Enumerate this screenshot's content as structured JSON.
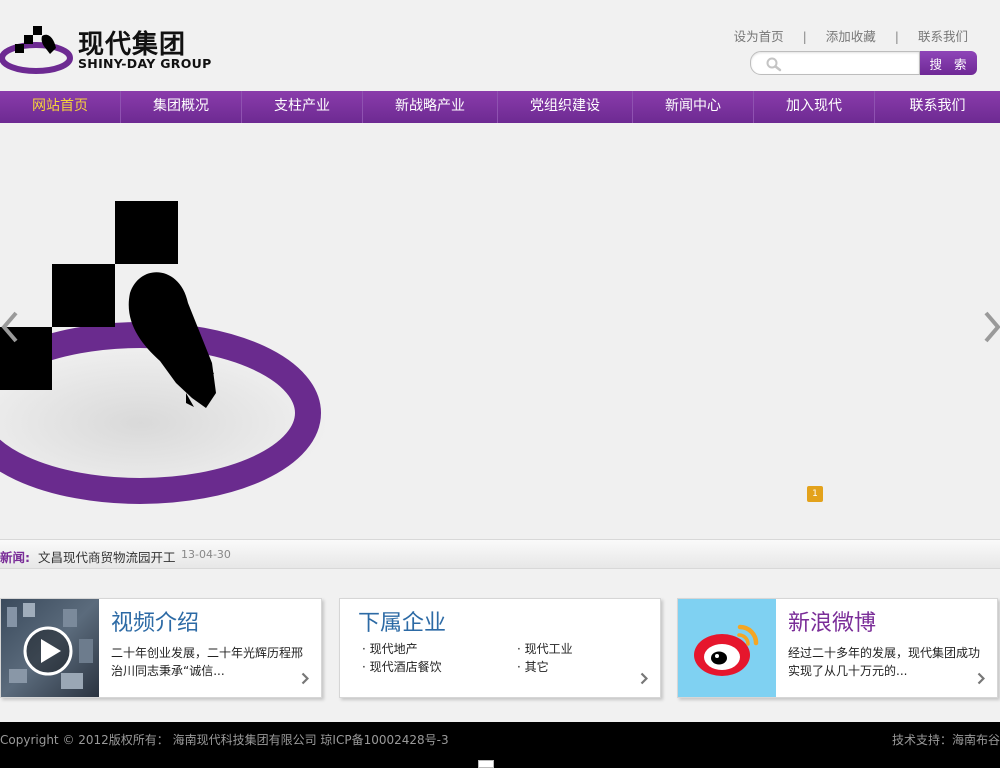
{
  "header": {
    "logo": {
      "title_cn": "现代集团",
      "title_en": "SHINY-DAY GROUP",
      "icon": "ink-brush-logo-icon",
      "colors": {
        "ring": "#6d2a92",
        "mark": "#000000"
      }
    },
    "top_links": [
      {
        "label": "设为首页"
      },
      {
        "label": "添加收藏"
      },
      {
        "label": "联系我们"
      }
    ],
    "separator": "|",
    "search": {
      "value": "",
      "placeholder": "",
      "button_label": "搜 索",
      "icon": "search-icon"
    }
  },
  "nav": {
    "colors": {
      "background": "#7a2d98",
      "active_text": "#f5d23c",
      "text": "#ffffff"
    },
    "items": [
      {
        "label": "网站首页",
        "active": true
      },
      {
        "label": "集团概况"
      },
      {
        "label": "支柱产业"
      },
      {
        "label": "新战略产业"
      },
      {
        "label": "党组织建设"
      },
      {
        "label": "新闻中心"
      },
      {
        "label": "加入现代"
      },
      {
        "label": "联系我们"
      }
    ]
  },
  "banner": {
    "slide_indicator": "1",
    "prev_icon": "chevron-left-icon",
    "next_icon": "chevron-right-icon",
    "image_icon": "ink-brush-logo-icon"
  },
  "news": {
    "label": "新闻:",
    "title": "文昌现代商贸物流园开工",
    "date": "13-04-30"
  },
  "boxes": {
    "video": {
      "title": "视频介绍",
      "text": "二十年创业发展，二十年光辉历程邢治川同志秉承“诚信...",
      "thumb_icon": "play-icon",
      "more_icon": "chevron-right-icon"
    },
    "corp": {
      "title": "下属企业",
      "items": [
        "· 现代地产",
        "· 现代工业",
        "· 现代酒店餐饮",
        "· 其它"
      ],
      "more_icon": "chevron-right-icon"
    },
    "weibo": {
      "title": "新浪微博",
      "text": "经过二十多年的发展，现代集团成功实现了从几十万元的...",
      "thumb_icon": "weibo-icon",
      "more_icon": "chevron-right-icon"
    }
  },
  "footer": {
    "copyright": "Copyright © 2012版权所有： 海南现代科技集团有限公司 琼ICP备10002428号-3",
    "support": "技术支持：海南布谷"
  }
}
